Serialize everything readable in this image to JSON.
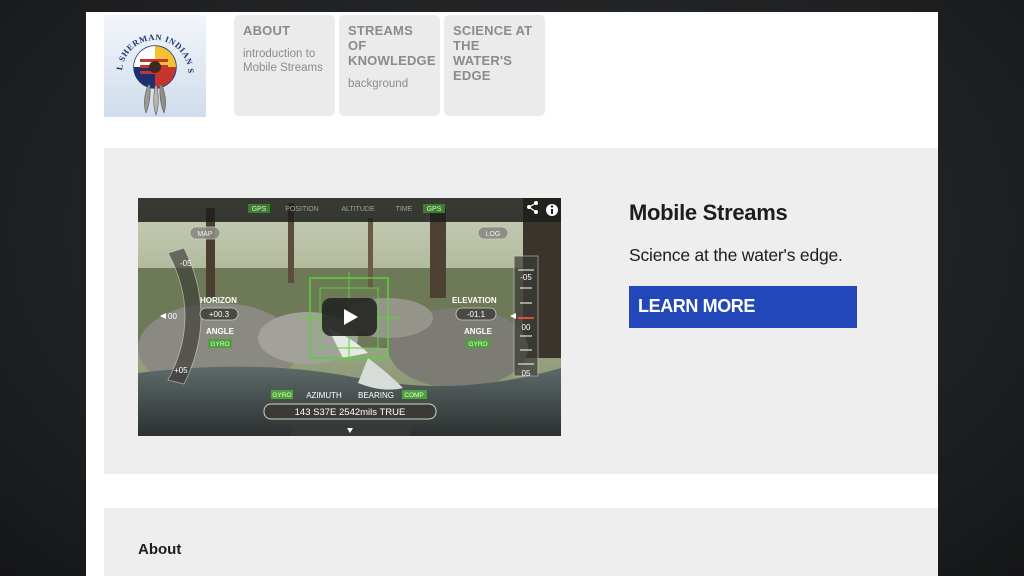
{
  "logo": {
    "text": "PASCHAL SHERMAN INDIAN SCHOOL"
  },
  "nav": [
    {
      "title": "ABOUT",
      "subtitle": "introduction to Mobile Streams"
    },
    {
      "title": "STREAMS OF KNOWLEDGE",
      "subtitle": "background"
    },
    {
      "title": "SCIENCE AT THE WATER'S EDGE",
      "subtitle": ""
    }
  ],
  "hero": {
    "title": "Mobile Streams",
    "subtitle": "Science at the water's edge.",
    "button_label": "LEARN MORE",
    "button_color": "#2147b8"
  },
  "video": {
    "share_icon": "share-icon",
    "info_icon": "info-icon",
    "play_icon": "play-icon",
    "hud": {
      "tabs": [
        "GPS",
        "POSITION",
        "ALTITUDE",
        "TIME",
        "GPS"
      ],
      "map_btn": "MAP",
      "log_btn": "LOG",
      "left_top": "-05",
      "left_mid": "00",
      "left_bot": "+05",
      "horizon_label": "HORIZON",
      "horizon_value": "+00.3",
      "angle_label_left": "ANGLE",
      "gyro_left": "GYRO",
      "elevation_label": "ELEVATION",
      "elevation_value": "-01.1",
      "angle_label_right": "ANGLE",
      "gyro_right": "GYRO",
      "right_top": "-05",
      "right_mid": "00",
      "right_bot": "05",
      "gyro_bottom": "GYRO",
      "azimuth_label": "AZIMUTH",
      "bearing_label": "BEARING",
      "comp_label": "COMP",
      "readout": "143   S37E   2542mils   TRUE"
    }
  },
  "about": {
    "heading": "About"
  }
}
